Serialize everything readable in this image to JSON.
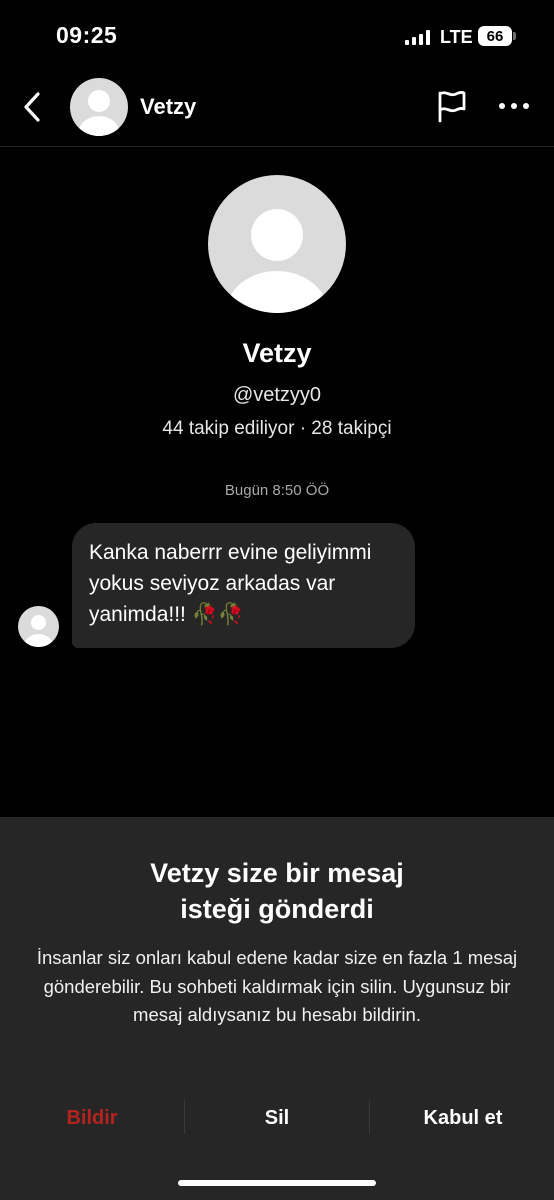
{
  "status_bar": {
    "time": "09:25",
    "network": "LTE",
    "battery": "66"
  },
  "header": {
    "back_icon": "chevron-left-icon",
    "name": "Vetzy",
    "report_icon": "flag-icon",
    "more_icon": "more-horizontal-icon"
  },
  "profile": {
    "name": "Vetzy",
    "handle": "@vetzyy0",
    "stats": "44 takip ediliyor · 28 takipçi"
  },
  "conversation": {
    "timestamp": "Bugün 8:50 ÖÖ",
    "messages": [
      {
        "text": "Kanka naberrr evine geliyimmi yokus seviyoz arkadas var yanimda!!! 🥀🥀"
      }
    ]
  },
  "request_sheet": {
    "title_line1": "Vetzy size bir mesaj",
    "title_line2": "isteği gönderdi",
    "body": "İnsanlar siz onları kabul edene kadar size en fazla 1 mesaj gönderebilir. Bu sohbeti kaldırmak için silin. Uygunsuz bir mesaj aldıysanız bu hesabı bildirin.",
    "actions": {
      "report": "Bildir",
      "delete": "Sil",
      "accept": "Kabul et"
    },
    "colors": {
      "report": "#b5231f",
      "default": "#ffffff"
    }
  }
}
